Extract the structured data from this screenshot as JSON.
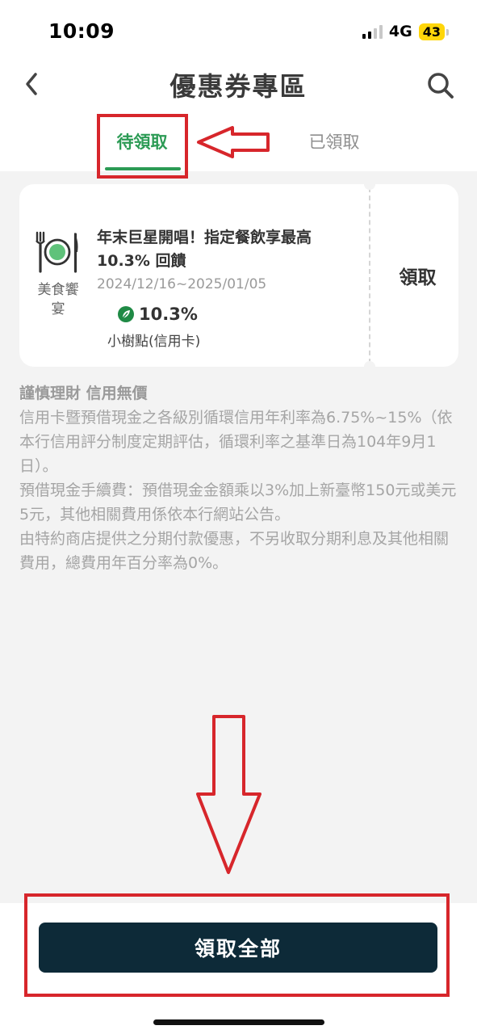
{
  "status_bar": {
    "time": "10:09",
    "network": "4G",
    "battery": "43"
  },
  "header": {
    "title": "優惠券專區"
  },
  "tabs": [
    {
      "label": "待領取",
      "active": true
    },
    {
      "label": "已領取",
      "active": false
    }
  ],
  "coupon": {
    "category": "美食饗宴",
    "title": "年末巨星開唱！指定餐飲享最高10.3% 回饋",
    "dates": "2024/12/16~2025/01/05",
    "reward_value": "10.3%",
    "reward_label": "小樹點(信用卡)",
    "claim_label": "領取"
  },
  "disclaimer": {
    "heading": "謹慎理財 信用無價",
    "lines": [
      "信用卡暨預借現金之各級別循環信用年利率為6.75%~15%（依本行信用評分制度定期評估，循環利率之基準日為104年9月1日）。",
      "預借現金手續費：預借現金金額乘以3%加上新臺幣150元或美元5元，其他相關費用係依本行網站公告。",
      "由特約商店提供之分期付款優惠，不另收取分期利息及其他相關費用，總費用年百分率為0%。"
    ]
  },
  "footer": {
    "claim_all_label": "領取全部"
  },
  "colors": {
    "accent": "#2c9b55",
    "button_dark": "#0d2a38",
    "annotation_red": "#d7262b"
  }
}
